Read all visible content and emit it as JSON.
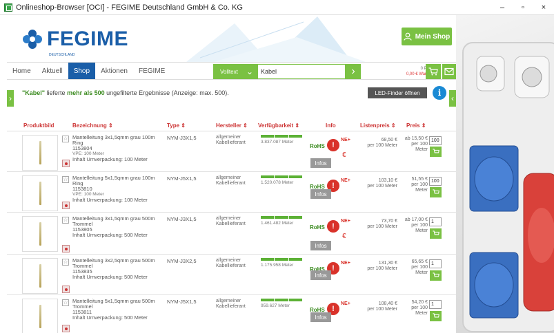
{
  "window": {
    "title": "Onlineshop-Browser [OCI] - FEGIME Deutschland GmbH & Co. KG",
    "min": "–",
    "max": "▫",
    "close": "×"
  },
  "header": {
    "logo_text": "FEGIME",
    "logo_sub": "DEUTSCHLAND",
    "myshop_label": "Mein Shop"
  },
  "nav": {
    "tabs": [
      "Home",
      "Aktuell",
      "Shop",
      "Aktionen",
      "FEGIME"
    ],
    "active": "Shop",
    "search_mode": "Volltext",
    "search_value": "Kabel",
    "cart_positions": "0 Position",
    "cart_value": "0,00 € Warenwert"
  },
  "results": {
    "query": "\"Kabel\"",
    "text_mid": " lieferte ",
    "highlight": "mehr als 500",
    "text_end": " ungefilterte Ergebnisse (Anzeige: max. 500).",
    "led_button": "LED-Finder öffnen"
  },
  "columns": {
    "image": "Produktbild",
    "desc": "Bezeichnung ⇕",
    "type": "Type ⇕",
    "maker": "Hersteller ⇕",
    "avail": "Verfügbarkeit ⇕",
    "info": "Info",
    "list": "Listenpreis ⇕",
    "price": "Preis ⇕"
  },
  "rows": [
    {
      "name": "Mantelleitung 3x1,5qmm grau 100m Ring",
      "article": "1153804",
      "vpe": "VPE: 100 Meter",
      "pack": "Inhalt Umverpackung: 100 Meter",
      "type": "NYM-J3X1,5",
      "maker1": "allgemeiner",
      "maker2": "Kabellieferant",
      "avail": "3.837.087 Meter",
      "rohs": "RoHS",
      "ne": "NE+",
      "infos": "Infos",
      "list": "68,50 €",
      "list_unit": "per 100 Meter",
      "price": "ab 15,50 €",
      "price_unit": "per 100",
      "price_unit2": "Meter",
      "qty": "100"
    },
    {
      "name": "Mantelleitung 5x1,5qmm grau 100m Ring",
      "article": "1153810",
      "vpe": "VPE: 100 Meter",
      "pack": "Inhalt Umverpackung: 100 Meter",
      "type": "NYM-J5X1,5",
      "maker1": "allgemeiner",
      "maker2": "Kabellieferant",
      "avail": "1.520.078 Meter",
      "rohs": "RoHS",
      "ne": "NE+",
      "infos": "Infos",
      "list": "103,10 €",
      "list_unit": "per 100 Meter",
      "price": "51,55 €",
      "price_unit": "per 100",
      "price_unit2": "Meter",
      "qty": "100"
    },
    {
      "name": "Mantelleitung 3x1,5qmm grau 500m Trommel",
      "article": "1153805",
      "vpe": "",
      "pack": "Inhalt Umverpackung: 500 Meter",
      "type": "NYM-J3X1,5",
      "maker1": "allgemeiner",
      "maker2": "Kabellieferant",
      "avail": "1.461.482 Meter",
      "rohs": "RoHS",
      "ne": "NE+",
      "infos": "Infos",
      "list": "73,70 €",
      "list_unit": "per 100 Meter",
      "price": "ab 17,00 €",
      "price_unit": "per 100",
      "price_unit2": "Meter",
      "qty": "1"
    },
    {
      "name": "Mantelleitung 3x2,5qmm grau 500m Trommel",
      "article": "1153835",
      "vpe": "",
      "pack": "Inhalt Umverpackung: 500 Meter",
      "type": "NYM-J3X2,5",
      "maker1": "allgemeiner",
      "maker2": "Kabellieferant",
      "avail": "1.175.958 Meter",
      "rohs": "RoHS",
      "ne": "NE+",
      "infos": "Infos",
      "list": "131,30 €",
      "list_unit": "per 100 Meter",
      "price": "65,65 €",
      "price_unit": "per 100",
      "price_unit2": "Meter",
      "qty": "1"
    },
    {
      "name": "Mantelleitung 5x1,5qmm grau 500m Trommel",
      "article": "1153811",
      "vpe": "",
      "pack": "Inhalt Umverpackung: 500 Meter",
      "type": "NYM-J5X1,5",
      "maker1": "allgemeiner",
      "maker2": "Kabellieferant",
      "avail": "959.627 Meter",
      "rohs": "RoHS",
      "ne": "NE+",
      "infos": "Infos",
      "list": "108,40 €",
      "list_unit": "per 100 Meter",
      "price": "54,20 €",
      "price_unit": "per 100",
      "price_unit2": "Meter",
      "qty": "1"
    }
  ],
  "colors": {
    "green": "#7ac143",
    "blue": "#1a5ea8",
    "red": "#d9322a"
  }
}
